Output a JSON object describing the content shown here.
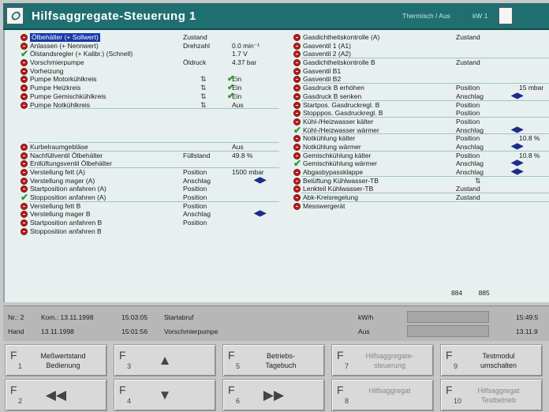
{
  "titlebar": {
    "title": "Hilfsaggregate-Steuerung 1",
    "status": "Thermisch / Aus",
    "unit": "kW 1"
  },
  "left_rows": [
    {
      "ind": "red",
      "name": "Ölbehälter (+ Sollwert)",
      "state": "Zustand",
      "val": "",
      "highlight": true
    },
    {
      "ind": "red",
      "name": "Anlassen (+ Nennwert)",
      "state": "Drehzahl",
      "val": "0.0 min⁻¹"
    },
    {
      "ind": "green",
      "name": "Ölstandsregler (+ Kalibr.) (Schnell)",
      "state": "",
      "val": "1.7 V"
    },
    {
      "ind": "red",
      "name": "Vorschmierpumpe",
      "state": "Öldruck",
      "val": "4.37 bar"
    },
    {
      "ind": "red",
      "name": "Vorheizung",
      "state": "",
      "val": ""
    },
    {
      "ind": "red",
      "name": "Pumpe Motorkühlkreis",
      "state": "",
      "val": "Ein",
      "sym": true,
      "check": true
    },
    {
      "ind": "red",
      "name": "Pumpe Heizkreis",
      "state": "",
      "val": "Ein",
      "sym": true,
      "check": true
    },
    {
      "ind": "red",
      "name": "Pumpe Gemischkühlkreis",
      "state": "",
      "val": "Ein",
      "sym": true,
      "check": true
    },
    {
      "ind": "red",
      "name": "Pumpe Notkühlkreis",
      "state": "",
      "val": "Aus",
      "sym": true,
      "sep": true
    },
    {
      "ind": "",
      "name": "",
      "state": "",
      "val": ""
    },
    {
      "ind": "",
      "name": "",
      "state": "",
      "val": ""
    },
    {
      "ind": "",
      "name": "",
      "state": "",
      "val": ""
    },
    {
      "ind": "",
      "name": "",
      "state": "",
      "val": "",
      "sep": true
    },
    {
      "ind": "red",
      "name": "Kurbelraumgebläse",
      "state": "",
      "val": "Aus",
      "sep": true
    },
    {
      "ind": "red",
      "name": "Nachfüllventil Ölbehälter",
      "state": "Füllstand",
      "val": "49.8 %"
    },
    {
      "ind": "red",
      "name": "Entlüftungsventil Ölbehälter",
      "state": "",
      "val": "",
      "sep": true
    },
    {
      "ind": "red",
      "name": "Verstellung fett (A)",
      "state": "Position",
      "val": "1500 mbar"
    },
    {
      "ind": "red",
      "name": "Verstellung mager (A)",
      "state": "Anschlag",
      "val": "",
      "arrow": true
    },
    {
      "ind": "red",
      "name": "Startposition anfahren (A)",
      "state": "Position",
      "val": ""
    },
    {
      "ind": "green",
      "name": "Stopposition anfahren (A)",
      "state": "Position",
      "val": "",
      "sep": true
    },
    {
      "ind": "red",
      "name": "Verstellung fett B",
      "state": "Position",
      "val": ""
    },
    {
      "ind": "red",
      "name": "Verstellung mager B",
      "state": "Anschlag",
      "val": "",
      "arrow": true
    },
    {
      "ind": "red",
      "name": "Startposition anfahren B",
      "state": "Position",
      "val": ""
    },
    {
      "ind": "red",
      "name": "Stopposition anfahren B",
      "state": "",
      "val": ""
    }
  ],
  "right_rows": [
    {
      "ind": "red",
      "name": "Gasdichtheitskontrolle (A)",
      "state": "Zustand",
      "val": ""
    },
    {
      "ind": "red",
      "name": "Gasventil 1 (A1)",
      "state": "",
      "val": ""
    },
    {
      "ind": "red",
      "name": "Gasventil 2 (A2)",
      "state": "",
      "val": "",
      "sep": true
    },
    {
      "ind": "red",
      "name": "Gasdichtheitskontrolle B",
      "state": "Zustand",
      "val": ""
    },
    {
      "ind": "red",
      "name": "Gasventil B1",
      "state": "",
      "val": ""
    },
    {
      "ind": "red",
      "name": "Gasventil B2",
      "state": "",
      "val": "",
      "sep": true
    },
    {
      "ind": "red",
      "name": "Gasdruck B erhöhen",
      "state": "Position",
      "val": "15 mbar"
    },
    {
      "ind": "red",
      "name": "Gasdruck B senken",
      "state": "Anschlag",
      "val": "",
      "arrow": true,
      "sep": true
    },
    {
      "ind": "red",
      "name": "Startpos. Gasdruckregl. B",
      "state": "Position",
      "val": ""
    },
    {
      "ind": "red",
      "name": "Stopppos. Gasdruckregl. B",
      "state": "Position",
      "val": "",
      "sep": true
    },
    {
      "ind": "red",
      "name": "Kühl-/Heizwasser kälter",
      "state": "Position",
      "val": ""
    },
    {
      "ind": "green",
      "name": "Kühl-/Heizwasser wärmer",
      "state": "Anschlag",
      "val": "",
      "arrow": true,
      "sep": true
    },
    {
      "ind": "red",
      "name": "Notkühlung kälter",
      "state": "Position",
      "val": "10.8 %"
    },
    {
      "ind": "red",
      "name": "Notkühlung wärmer",
      "state": "Anschlag",
      "val": "",
      "arrow": true,
      "sep": true
    },
    {
      "ind": "red",
      "name": "Gemischkühlung kälter",
      "state": "Position",
      "val": "10.8 %"
    },
    {
      "ind": "green",
      "name": "Gemischkühlung wärmer",
      "state": "Anschlag",
      "val": "",
      "arrow": true
    },
    {
      "ind": "red",
      "name": "Abgasbypassklappe",
      "state": "Anschlag",
      "val": "",
      "arrow": true,
      "sep": true
    },
    {
      "ind": "red",
      "name": "Belüftung Kühlwasser-TB",
      "state": "",
      "val": "",
      "sym": true
    },
    {
      "ind": "red",
      "name": "Lenkteil Kühlwasser-TB",
      "state": "Zustand",
      "val": "",
      "sep": true
    },
    {
      "ind": "red",
      "name": "Abk-Kreisregelung",
      "state": "Zustand",
      "val": "",
      "sep": true
    },
    {
      "ind": "red",
      "name": "Messwergerät",
      "state": "",
      "val": ""
    }
  ],
  "bottom_values": [
    "884",
    "885"
  ],
  "status": {
    "row1": {
      "nr": "Nr.: 2",
      "kom": "Kom.: 13.11.1998",
      "time": "15:03:05",
      "text": "Startabruf",
      "mode": "kW/h",
      "right": "15:49:5"
    },
    "row2": {
      "nr": "Hand",
      "kom": "13.11.1998",
      "time": "15:01:56",
      "text": "Vorschmierpumpe",
      "mode": "Aus",
      "right": "13.11.9"
    }
  },
  "fkeys": [
    {
      "n": "1",
      "label": "Meßwertstand\nBedienung",
      "glyph": ""
    },
    {
      "n": "3",
      "label": "",
      "glyph": "▲"
    },
    {
      "n": "5",
      "label": "Betriebs-\nTagebuch",
      "glyph": ""
    },
    {
      "n": "7",
      "label": "Hilfsaggregate-\nsteuerung",
      "glyph": "",
      "dim": true
    },
    {
      "n": "9",
      "label": "Testmodul\numschalten",
      "glyph": ""
    },
    {
      "n": "2",
      "label": "",
      "glyph": "◀◀"
    },
    {
      "n": "4",
      "label": "",
      "glyph": "▼"
    },
    {
      "n": "6",
      "label": "",
      "glyph": "▶▶"
    },
    {
      "n": "8",
      "label": "Hilfsaggregat",
      "glyph": "",
      "dim": true
    },
    {
      "n": "10",
      "label": "Hilfsaggregat\nTestbetrieb",
      "glyph": "",
      "dim": true
    }
  ],
  "colors": {
    "titlebar": "#1f6f71",
    "panel": "#e7f0ef",
    "indicator_red": "#b81d1d",
    "indicator_green": "#2a9b2a",
    "arrow_blue": "#1a2c8a"
  }
}
